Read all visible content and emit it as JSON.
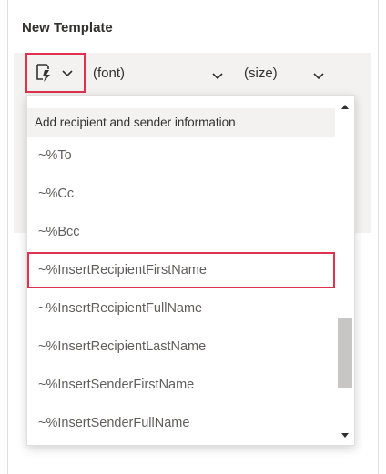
{
  "pane": {
    "title": "New Template"
  },
  "toolbar": {
    "insert_icon": "insert-field-icon",
    "font_value": "(font)",
    "size_value": "(size)"
  },
  "dropdown": {
    "header": "Add recipient and sender information",
    "items": [
      {
        "label": "~%To"
      },
      {
        "label": "~%Cc"
      },
      {
        "label": "~%Bcc"
      },
      {
        "label": "~%InsertRecipientFirstName",
        "highlighted": true
      },
      {
        "label": "~%InsertRecipientFullName"
      },
      {
        "label": "~%InsertRecipientLastName"
      },
      {
        "label": "~%InsertSenderFirstName"
      },
      {
        "label": "~%InsertSenderFullName"
      }
    ]
  },
  "colors": {
    "highlight": "#e0314f",
    "toolbar_bg": "#f3f2f1",
    "scroll_thumb": "#c8c6c4"
  }
}
